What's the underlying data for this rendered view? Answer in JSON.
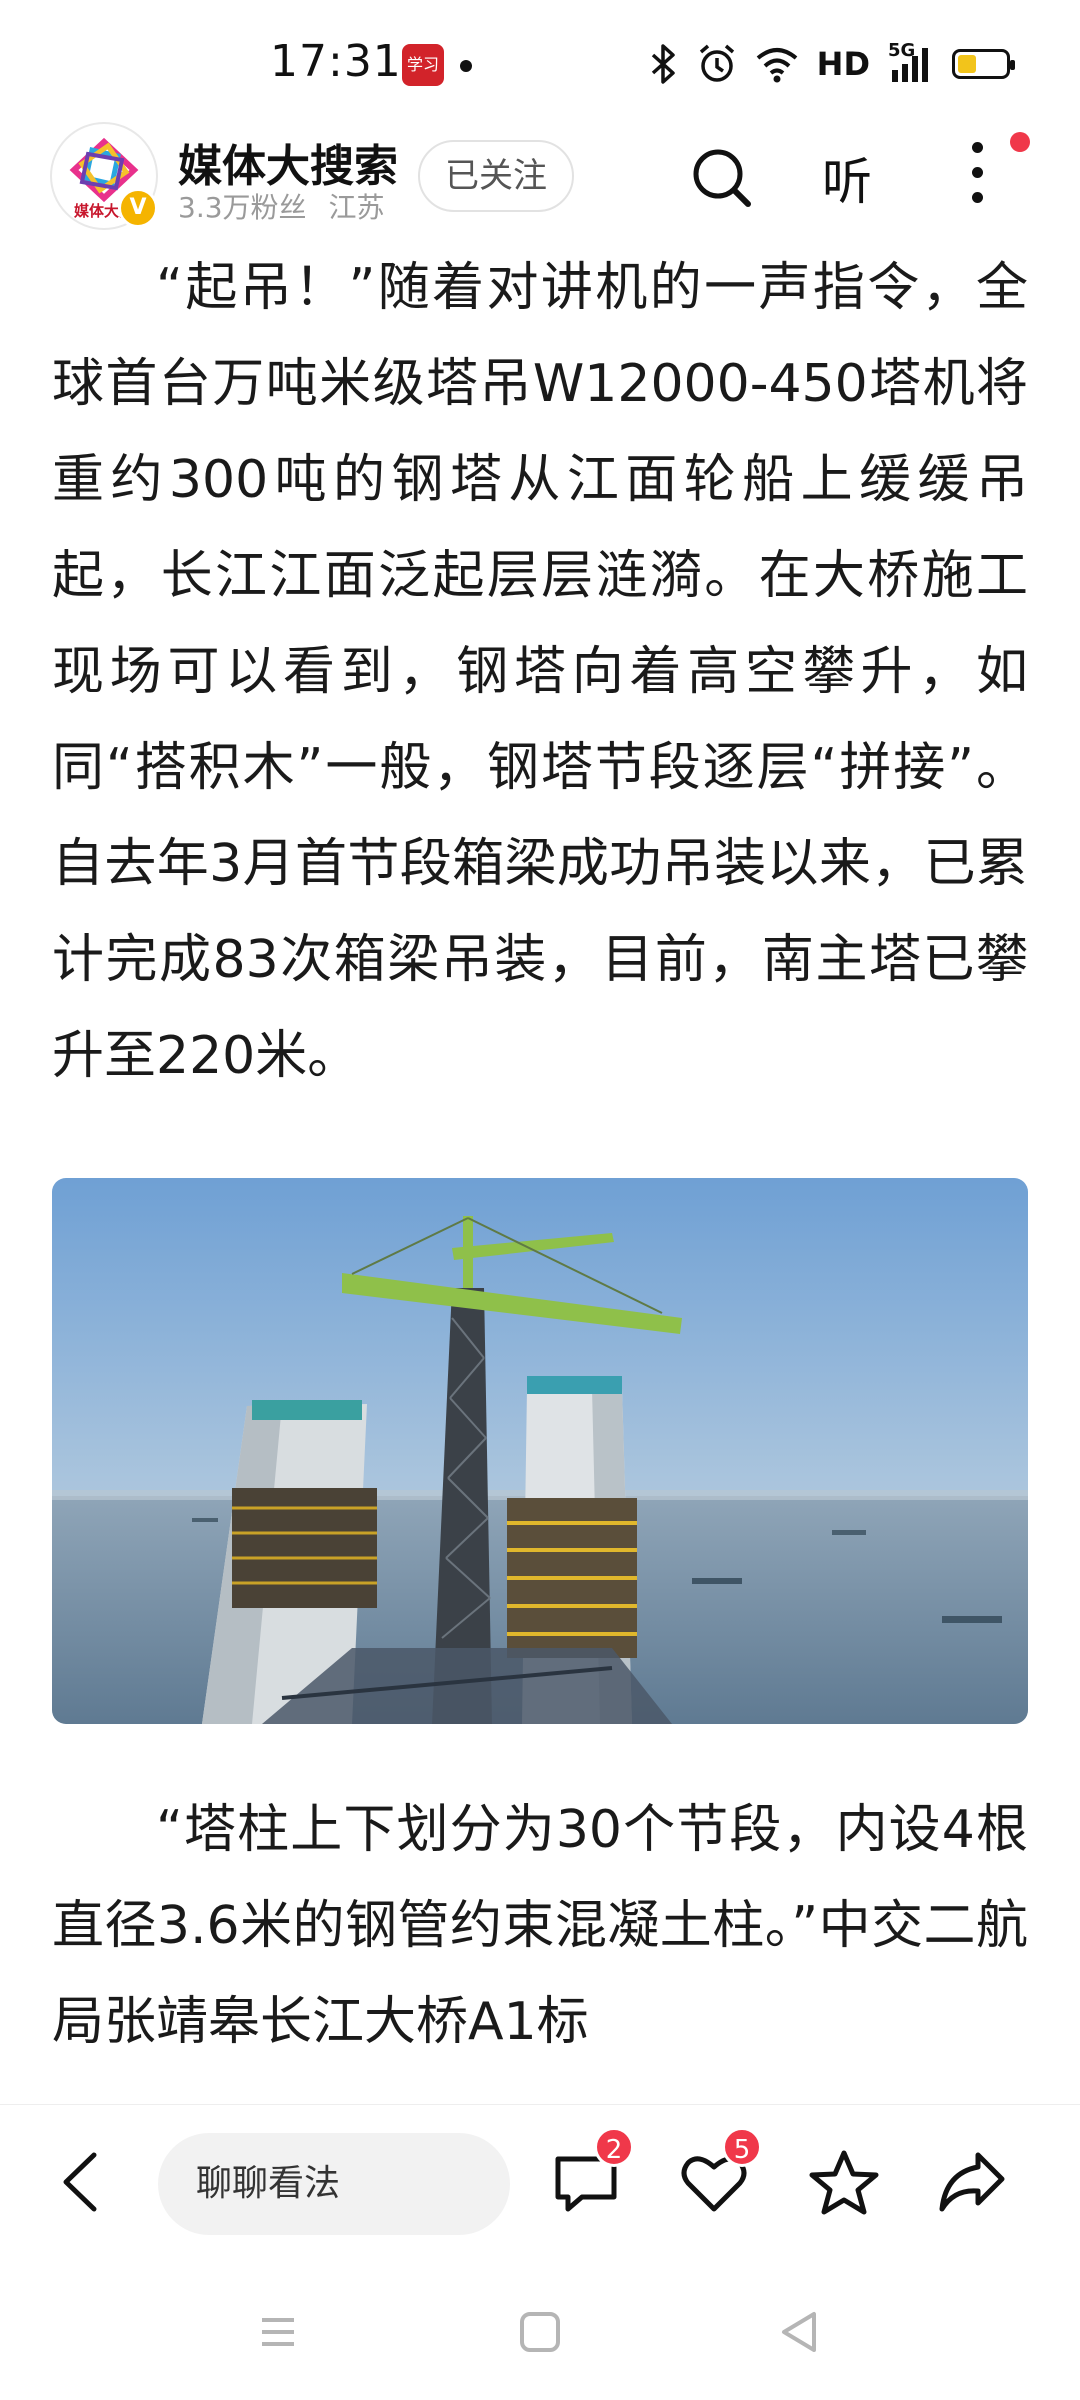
{
  "status_bar": {
    "time": "17:31",
    "app_icon_text": "学习",
    "network_hd": "HD",
    "network_5g": "5G",
    "battery_level": 0.4,
    "icons": [
      "bluetooth-icon",
      "alarm-icon",
      "wifi-icon",
      "signal-icon",
      "battery-icon"
    ]
  },
  "header": {
    "account_name": "媒体大搜索",
    "logo_text": "媒体大搜",
    "verified_mark": "V",
    "followers": "3.3万粉丝",
    "location": "江苏",
    "follow_label": "已关注",
    "listen_label": "听",
    "colors": {
      "verified": "#f5b400",
      "notification_dot": "#f0384a"
    }
  },
  "article": {
    "paragraph_1": "“起吊！”随着对讲机的一声指令，全球首台万吨米级塔吊W12000-450塔机将重约300吨的钢塔从江面轮船上缓缓吊起，长江江面泛起层层涟漪。在大桥施工现场可以看到，钢塔向着高空攀升，如同“搭积木”一般，钢塔节段逐层“拼接”。自去年3月首节段箱梁成功吊装以来，已累计完成83次箱梁吊装，目前，南主塔已攀升至220米。",
    "paragraph_2": "“塔柱上下划分为30个节段，内设4根直径3.6米的钢管约束混凝土柱。”中交二航局张靖皋长江大桥A1标"
  },
  "bottom_bar": {
    "comment_placeholder": "聊聊看法",
    "comment_count": "2",
    "like_count": "5",
    "icons": [
      "back-icon",
      "comment-icon",
      "heart-icon",
      "star-icon",
      "share-icon"
    ]
  },
  "nav_bar": {
    "icons": [
      "menu-icon",
      "home-icon",
      "back-triangle-icon"
    ]
  }
}
